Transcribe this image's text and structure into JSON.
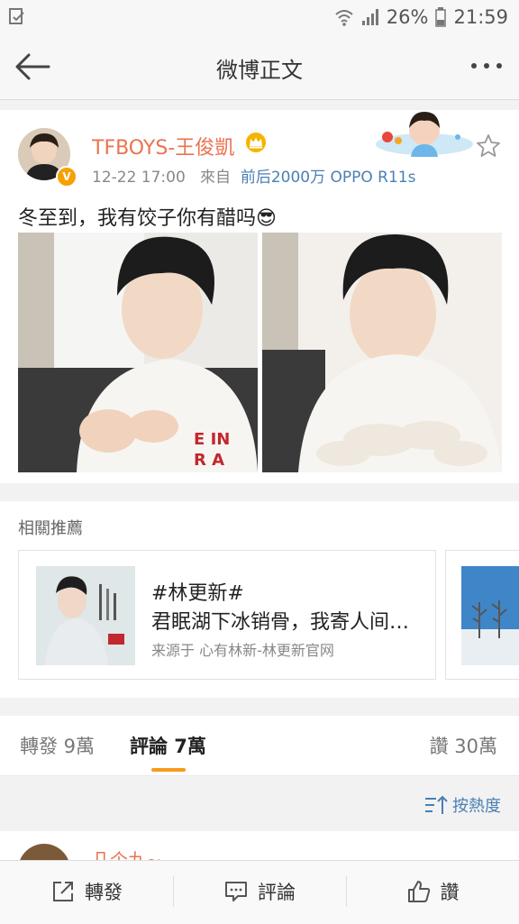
{
  "status_bar": {
    "battery": "26%",
    "time": "21:59"
  },
  "nav": {
    "title": "微博正文"
  },
  "post": {
    "username": "TFBOYS-王俊凱",
    "time": "12-22 17:00",
    "from_label": "來自",
    "source": "前后2000万 OPPO R11s",
    "text": "冬至到，我有饺子你有醋吗😎"
  },
  "recommend": {
    "title": "相關推薦",
    "card": {
      "tag": "#林更新#",
      "line": "君眠湖下冰销骨，我寄人间…",
      "source": "来源于 心有林新-林更新官网"
    }
  },
  "tabs": {
    "repost": "轉發 9萬",
    "comment": "評論 7萬",
    "like": "讚 30萬"
  },
  "sort": {
    "label": "按熱度"
  },
  "comment_preview": {
    "name": "几个九~"
  },
  "bottom": {
    "repost": "轉發",
    "comment": "評論",
    "like": "讚"
  },
  "colors": {
    "accent": "#f79a1c",
    "username": "#eb7350",
    "link": "#4a7fb5"
  }
}
